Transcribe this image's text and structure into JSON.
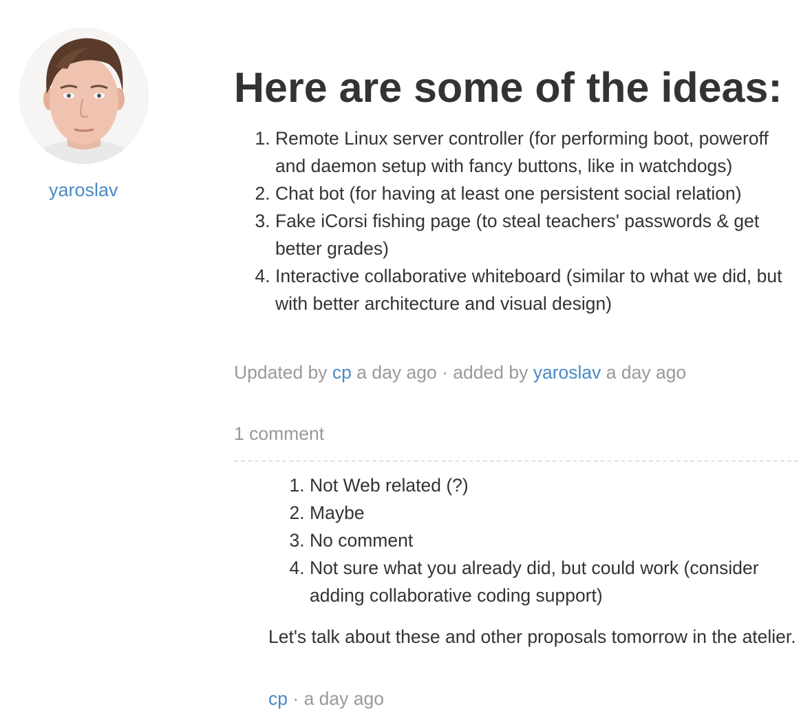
{
  "author": {
    "avatar_icon": "user-avatar-photo",
    "name": "yaroslav"
  },
  "post": {
    "title": "Here are some of the ideas:",
    "ideas": [
      "Remote Linux server controller (for performing boot, poweroff and daemon setup with fancy buttons, like in watchdogs)",
      "Chat bot (for having at least one persistent social relation)",
      "Fake iCorsi fishing page (to steal teachers' passwords & get better grades)",
      "Interactive collaborative whiteboard (similar to what we did, but with better architecture and visual design)"
    ],
    "meta": {
      "updated_prefix": "Updated by",
      "updated_by": "cp",
      "updated_time": "a day ago",
      "separator": "·",
      "added_prefix": "added by",
      "added_by": "yaroslav",
      "added_time": "a day ago"
    }
  },
  "comments": {
    "count_label": "1 comment",
    "items": [
      {
        "list": [
          "Not Web related (?)",
          "Maybe",
          "No comment",
          "Not sure what you already did, but could work (consider adding collaborative coding support)"
        ],
        "text": "Let's talk about these and other proposals tomorrow in the atelier.",
        "author": "cp",
        "separator": "·",
        "time": "a day ago"
      }
    ]
  },
  "colors": {
    "link": "#4a89c4",
    "muted": "#999999",
    "text": "#333333"
  }
}
